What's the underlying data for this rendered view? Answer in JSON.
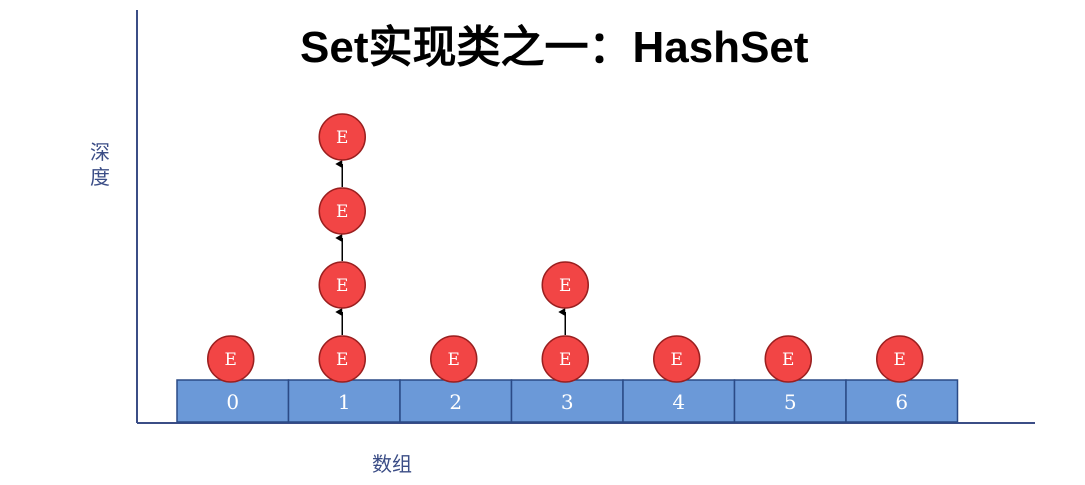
{
  "title": "Set实现类之一：HashSet",
  "y_axis_label": "深度",
  "x_axis_label": "数组",
  "node_label": "E",
  "array_indices": [
    "0",
    "1",
    "2",
    "3",
    "4",
    "5",
    "6"
  ],
  "chain_depths": [
    1,
    4,
    1,
    2,
    1,
    1,
    1
  ],
  "colors": {
    "axis": "#3b4d86",
    "cell_fill": "#6b99d8",
    "cell_stroke": "#2b4a86",
    "node_fill": "#f24545",
    "node_stroke": "#9a1f1f",
    "arrow": "#000000"
  }
}
